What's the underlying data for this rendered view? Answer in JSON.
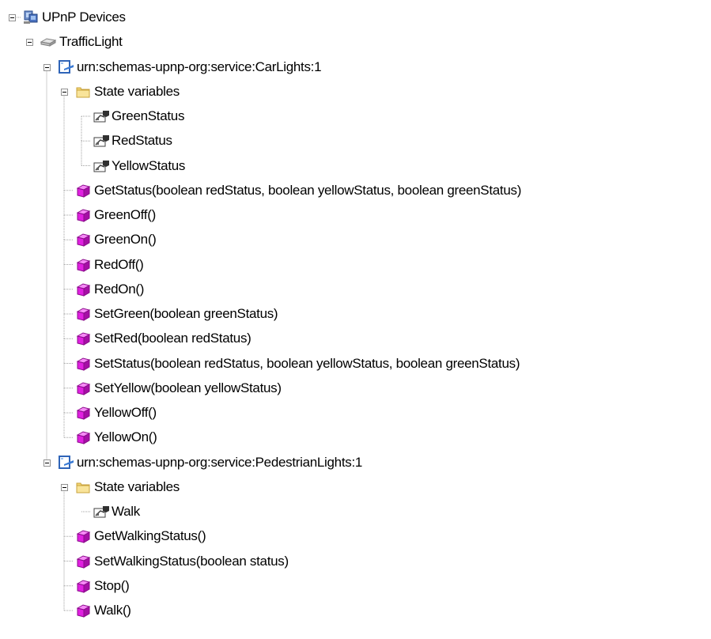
{
  "tree": {
    "root": {
      "label": "UPnP Devices",
      "icon": "network-computers-icon",
      "children": [
        {
          "label": "TrafficLight",
          "icon": "device-icon",
          "children": [
            {
              "label": "urn:schemas-upnp-org:service:CarLights:1",
              "icon": "service-icon",
              "state_folder": {
                "label": "State variables",
                "icon": "folder-icon",
                "items": [
                  {
                    "label": "GreenStatus",
                    "icon": "state-variable-icon"
                  },
                  {
                    "label": "RedStatus",
                    "icon": "state-variable-icon"
                  },
                  {
                    "label": "YellowStatus",
                    "icon": "state-variable-icon"
                  }
                ]
              },
              "actions": [
                {
                  "label": "GetStatus(boolean redStatus, boolean yellowStatus, boolean greenStatus)",
                  "icon": "action-cube-icon"
                },
                {
                  "label": "GreenOff()",
                  "icon": "action-cube-icon"
                },
                {
                  "label": "GreenOn()",
                  "icon": "action-cube-icon"
                },
                {
                  "label": "RedOff()",
                  "icon": "action-cube-icon"
                },
                {
                  "label": "RedOn()",
                  "icon": "action-cube-icon"
                },
                {
                  "label": "SetGreen(boolean greenStatus)",
                  "icon": "action-cube-icon"
                },
                {
                  "label": "SetRed(boolean redStatus)",
                  "icon": "action-cube-icon"
                },
                {
                  "label": "SetStatus(boolean redStatus, boolean yellowStatus, boolean greenStatus)",
                  "icon": "action-cube-icon"
                },
                {
                  "label": "SetYellow(boolean yellowStatus)",
                  "icon": "action-cube-icon"
                },
                {
                  "label": "YellowOff()",
                  "icon": "action-cube-icon"
                },
                {
                  "label": "YellowOn()",
                  "icon": "action-cube-icon"
                }
              ]
            },
            {
              "label": "urn:schemas-upnp-org:service:PedestrianLights:1",
              "icon": "service-icon",
              "state_folder": {
                "label": "State variables",
                "icon": "folder-icon",
                "items": [
                  {
                    "label": "Walk",
                    "icon": "state-variable-icon"
                  }
                ]
              },
              "actions": [
                {
                  "label": "GetWalkingStatus()",
                  "icon": "action-cube-icon"
                },
                {
                  "label": "SetWalkingStatus(boolean status)",
                  "icon": "action-cube-icon"
                },
                {
                  "label": "Stop()",
                  "icon": "action-cube-icon"
                },
                {
                  "label": "Walk()",
                  "icon": "action-cube-icon"
                }
              ]
            }
          ]
        }
      ]
    }
  },
  "colors": {
    "text": "#000000",
    "tree_line": "#a0a0a0",
    "expander_border": "#919191",
    "action_cube": "#e020e0",
    "folder": "#f2d675",
    "service_blue": "#3a7bd5"
  }
}
